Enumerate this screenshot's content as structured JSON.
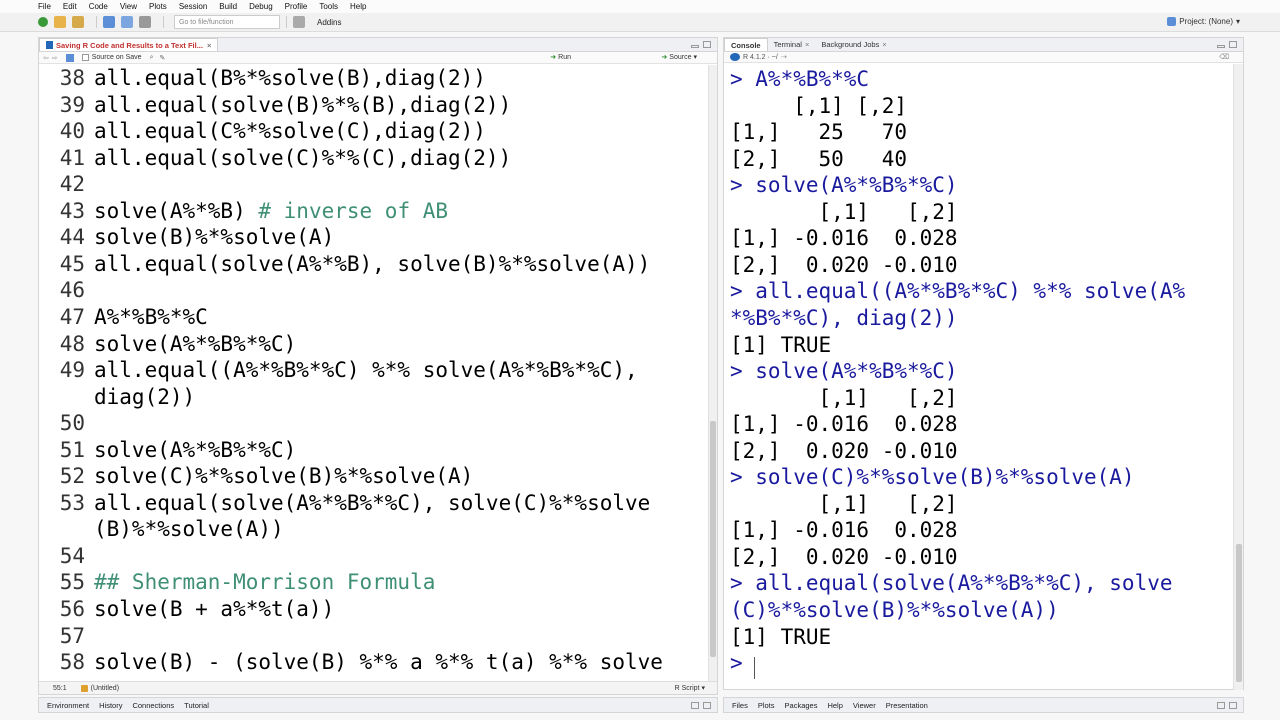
{
  "menu": [
    "File",
    "Edit",
    "Code",
    "View",
    "Plots",
    "Session",
    "Build",
    "Debug",
    "Profile",
    "Tools",
    "Help"
  ],
  "toolbar": {
    "goto_placeholder": "Go to file/function",
    "addins_label": "Addins",
    "project_label": "Project: (None)"
  },
  "editor": {
    "tab_title": "Saving R Code and Results to a Text Fil...",
    "source_on_save_label": "Source on Save",
    "run_label": "Run",
    "source_label": "Source",
    "lines": [
      {
        "num": "38",
        "code": "all.equal(B%*%solve(B),diag(2))"
      },
      {
        "num": "39",
        "code": "all.equal(solve(B)%*%(B),diag(2))"
      },
      {
        "num": "40",
        "code": "all.equal(C%*%solve(C),diag(2))"
      },
      {
        "num": "41",
        "code": "all.equal(solve(C)%*%(C),diag(2))"
      },
      {
        "num": "42",
        "code": ""
      },
      {
        "num": "43",
        "code": "solve(A%*%B) ",
        "comment": "# inverse of AB"
      },
      {
        "num": "44",
        "code": "solve(B)%*%solve(A)"
      },
      {
        "num": "45",
        "code": "all.equal(solve(A%*%B), solve(B)%*%solve(A))"
      },
      {
        "num": "46",
        "code": ""
      },
      {
        "num": "47",
        "code": "A%*%B%*%C"
      },
      {
        "num": "48",
        "code": "solve(A%*%B%*%C)"
      },
      {
        "num": "49",
        "code": "all.equal((A%*%B%*%C) %*% solve(A%*%B%*%C),"
      },
      {
        "num": "",
        "code": "diag(2))"
      },
      {
        "num": "50",
        "code": ""
      },
      {
        "num": "51",
        "code": "solve(A%*%B%*%C)"
      },
      {
        "num": "52",
        "code": "solve(C)%*%solve(B)%*%solve(A)"
      },
      {
        "num": "53",
        "code": "all.equal(solve(A%*%B%*%C), solve(C)%*%solve"
      },
      {
        "num": "",
        "code": "(B)%*%solve(A))"
      },
      {
        "num": "54",
        "code": ""
      },
      {
        "num": "55",
        "code": "",
        "comment": "## Sherman-Morrison Formula"
      },
      {
        "num": "56",
        "code": "solve(B + a%*%t(a))"
      },
      {
        "num": "57",
        "code": ""
      },
      {
        "num": "58",
        "code": "solve(B) - (solve(B) %*% a %*% t(a) %*% solve"
      }
    ],
    "status_position": "55:1",
    "status_scope": "(Untitled)",
    "status_filetype": "R Script"
  },
  "console": {
    "tabs": [
      "Console",
      "Terminal",
      "Background Jobs"
    ],
    "r_version": "R 4.1.2 · ~/",
    "lines": [
      {
        "type": "cmd",
        "text": "> A%*%B%*%C"
      },
      {
        "type": "out",
        "text": "     [,1] [,2]"
      },
      {
        "type": "out",
        "text": "[1,]   25   70"
      },
      {
        "type": "out",
        "text": "[2,]   50   40"
      },
      {
        "type": "cmd",
        "text": "> solve(A%*%B%*%C)"
      },
      {
        "type": "out",
        "text": "       [,1]   [,2]"
      },
      {
        "type": "out",
        "text": "[1,] -0.016  0.028"
      },
      {
        "type": "out",
        "text": "[2,]  0.020 -0.010"
      },
      {
        "type": "cmd",
        "text": "> all.equal((A%*%B%*%C) %*% solve(A%"
      },
      {
        "type": "cmd",
        "text": "*%B%*%C), diag(2))"
      },
      {
        "type": "out",
        "text": "[1] TRUE"
      },
      {
        "type": "cmd",
        "text": "> solve(A%*%B%*%C)"
      },
      {
        "type": "out",
        "text": "       [,1]   [,2]"
      },
      {
        "type": "out",
        "text": "[1,] -0.016  0.028"
      },
      {
        "type": "out",
        "text": "[2,]  0.020 -0.010"
      },
      {
        "type": "cmd",
        "text": "> solve(C)%*%solve(B)%*%solve(A)"
      },
      {
        "type": "out",
        "text": "       [,1]   [,2]"
      },
      {
        "type": "out",
        "text": "[1,] -0.016  0.028"
      },
      {
        "type": "out",
        "text": "[2,]  0.020 -0.010"
      },
      {
        "type": "cmd",
        "text": "> all.equal(solve(A%*%B%*%C), solve"
      },
      {
        "type": "cmd",
        "text": "(C)%*%solve(B)%*%solve(A))"
      },
      {
        "type": "out",
        "text": "[1] TRUE"
      },
      {
        "type": "cmd",
        "text": "> "
      }
    ]
  },
  "bottom_left_tabs": [
    "Environment",
    "History",
    "Connections",
    "Tutorial"
  ],
  "bottom_right_tabs": [
    "Files",
    "Plots",
    "Packages",
    "Help",
    "Viewer",
    "Presentation"
  ],
  "colors": {
    "console_command": "#1a1a9e",
    "comment": "#3f8f76",
    "r_logo": "#2266b8"
  }
}
